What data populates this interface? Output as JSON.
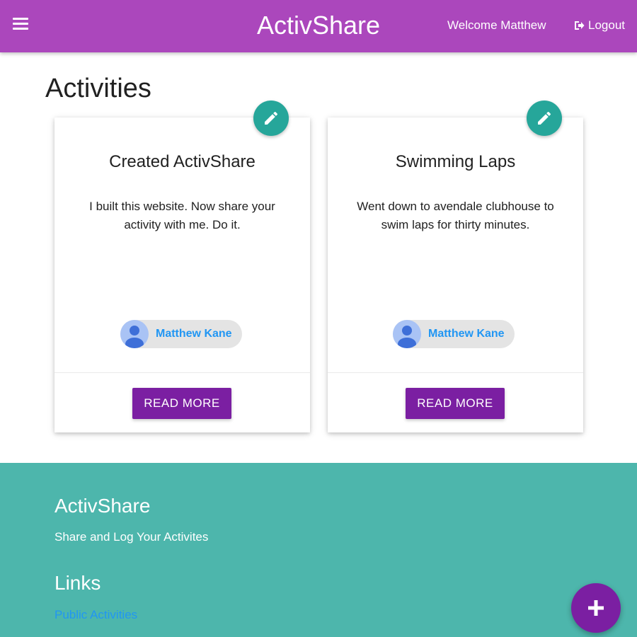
{
  "navbar": {
    "brand": "ActivShare",
    "welcome": "Welcome Matthew",
    "logout_label": "Logout",
    "background_color": "#ab47bc",
    "menu_icon": "hamburger-menu-icon",
    "logout_icon": "sign-out-icon"
  },
  "page": {
    "title": "Activities"
  },
  "activities": [
    {
      "title": "Created ActivShare",
      "description": "I built this website. Now share your activity with me. Do it.",
      "author": "Matthew Kane",
      "button_label": "READ MORE",
      "edit_icon": "pencil-icon"
    },
    {
      "title": "Swimming Laps",
      "description": "Went down to avendale clubhouse to swim laps for thirty minutes.",
      "author": "Matthew Kane",
      "button_label": "READ MORE",
      "edit_icon": "pencil-icon"
    }
  ],
  "footer": {
    "title": "ActivShare",
    "tagline": "Share and Log Your Activites",
    "links_title": "Links",
    "links": [
      "Public Activities"
    ],
    "background_color": "#4db6ac"
  },
  "fab": {
    "icon": "plus-icon",
    "color": "#7b1fa2"
  },
  "colors": {
    "edit_button": "#26a69a",
    "read_more_button": "#7b1fa2",
    "link": "#2196f3"
  }
}
